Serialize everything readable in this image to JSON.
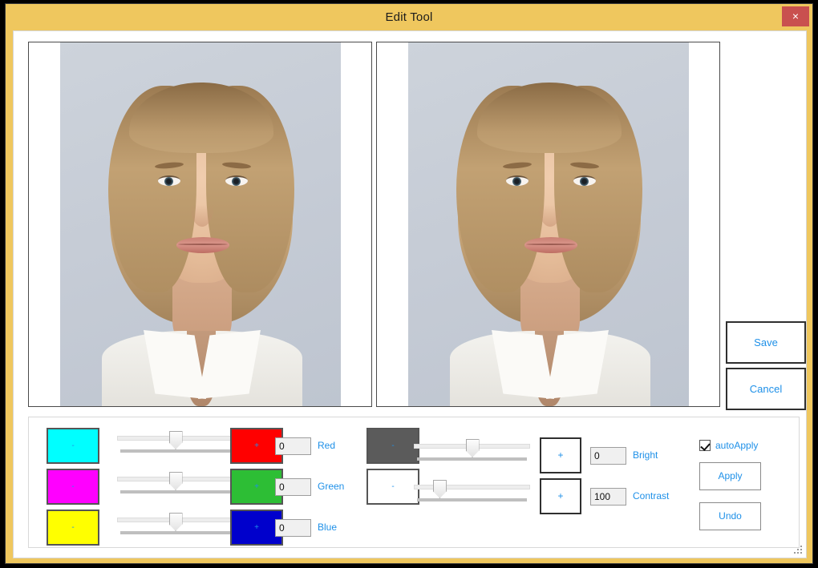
{
  "window": {
    "title": "Edit Tool",
    "close_label": "×",
    "titlebar_color": "#EFC75E",
    "close_color": "#C9504F",
    "accent_text_color": "#1E90E8"
  },
  "panels": {
    "original_name": "original-image-panel",
    "preview_name": "preview-image-panel"
  },
  "side_actions": {
    "save_label": "Save",
    "cancel_label": "Cancel"
  },
  "controls": {
    "subtract_symbol": "-",
    "add_symbol": "+",
    "color_minus_buttons": [
      {
        "name": "cyan-minus-button",
        "color": "#00FFFF",
        "label": "-"
      },
      {
        "name": "magenta-minus-button",
        "color": "#FF00FF",
        "label": "-"
      },
      {
        "name": "yellow-minus-button",
        "color": "#FFFF00",
        "label": "-"
      }
    ],
    "color_plus_buttons": [
      {
        "name": "red-plus-button",
        "color": "#FF0000",
        "label": "+"
      },
      {
        "name": "green-plus-button",
        "color": "#2DBE35",
        "label": "+"
      },
      {
        "name": "blue-plus-button",
        "color": "#0000CC",
        "label": "+"
      }
    ],
    "tone_minus_buttons": [
      {
        "name": "darken-button",
        "color": "#5B5B5B",
        "label": "-"
      },
      {
        "name": "lighten-button",
        "color": "#FFFFFF",
        "label": "-"
      }
    ],
    "channels": [
      {
        "label": "Red",
        "value": "0",
        "slider_percent": 50
      },
      {
        "label": "Green",
        "value": "0",
        "slider_percent": 50
      },
      {
        "label": "Blue",
        "value": "0",
        "slider_percent": 50
      }
    ],
    "tone": [
      {
        "label": "Bright",
        "value": "0",
        "slider_percent": 50,
        "plus_label": "+"
      },
      {
        "label": "Contrast",
        "value": "100",
        "slider_percent": 22,
        "plus_label": "+"
      }
    ],
    "auto_apply": {
      "label": "autoApply",
      "checked": true
    },
    "apply_label": "Apply",
    "undo_label": "Undo"
  }
}
